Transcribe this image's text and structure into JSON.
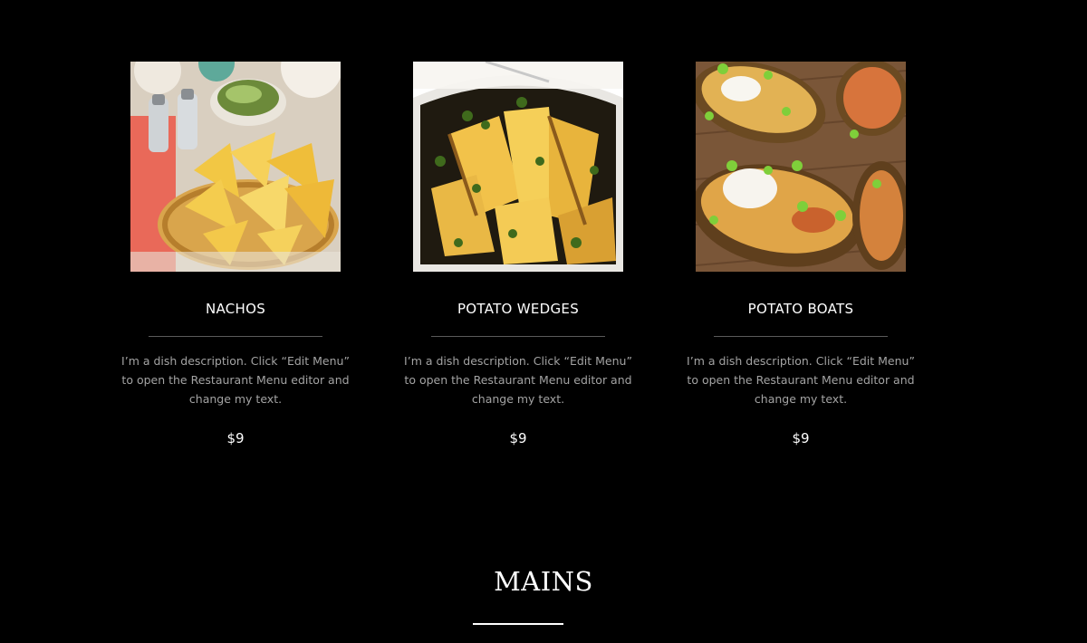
{
  "menu": {
    "items": [
      {
        "name": "NACHOS",
        "description": "I’m a dish description. Click “Edit Menu” to open the Restaurant Menu editor and change my text.",
        "price": "$9",
        "image_alt": "nachos-photo"
      },
      {
        "name": "POTATO WEDGES",
        "description": "I’m a dish description. Click “Edit Menu” to open the Restaurant Menu editor and change my text.",
        "price": "$9",
        "image_alt": "potato-wedges-photo"
      },
      {
        "name": "POTATO BOATS",
        "description": "I’m a dish description. Click “Edit Menu” to open the Restaurant Menu editor and change my text.",
        "price": "$9",
        "image_alt": "potato-boats-photo"
      }
    ]
  },
  "section": {
    "title": "MAINS"
  },
  "colors": {
    "background": "#000000",
    "text": "#ffffff",
    "description_text": "#a3a3a3",
    "divider": "#5a5a5a"
  }
}
